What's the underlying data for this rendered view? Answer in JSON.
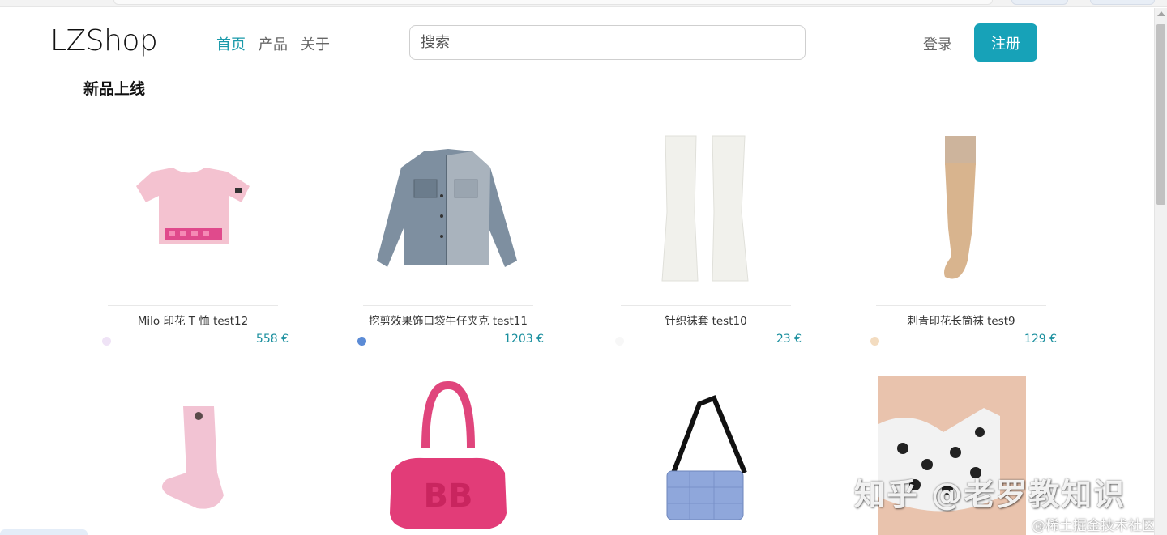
{
  "brand": {
    "logo": "LZShop"
  },
  "nav": {
    "links": [
      "首页",
      "产品",
      "关于"
    ],
    "active_index": 0
  },
  "search": {
    "placeholder": "搜索"
  },
  "auth": {
    "login": "登录",
    "register": "注册"
  },
  "section": {
    "title": "新品上线"
  },
  "products": [
    {
      "name": "Milo 印花 T 恤 test12",
      "price": "558 €",
      "color": "#efe3f6",
      "icon": "pink-tshirt-image"
    },
    {
      "name": "挖剪效果饰口袋牛仔夹克 test11",
      "price": "1203 €",
      "color": "#5b8bd6",
      "icon": "denim-jacket-image"
    },
    {
      "name": "针织袜套 test10",
      "price": "23 €",
      "color": "#f7f7f7",
      "icon": "knit-leg-warmers-image"
    },
    {
      "name": "刺青印花长筒袜 test9",
      "price": "129 €",
      "color": "#f3dcc0",
      "icon": "stocking-image"
    },
    {
      "name": "",
      "price": "",
      "color": "",
      "icon": "pink-sock-image"
    },
    {
      "name": "",
      "price": "",
      "color": "",
      "icon": "pink-bag-image"
    },
    {
      "name": "",
      "price": "",
      "color": "",
      "icon": "blue-crossbody-bag-image"
    },
    {
      "name": "",
      "price": "",
      "color": "",
      "icon": "printed-crop-top-image"
    }
  ],
  "watermark": {
    "main": "知乎 @老罗教知识",
    "sub": "@稀土掘金技术社区"
  },
  "colors": {
    "accent": "#17a2b8",
    "price": "#1a8f9e"
  }
}
